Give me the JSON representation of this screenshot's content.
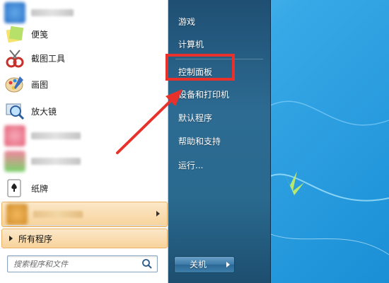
{
  "start_menu": {
    "programs": [
      {
        "label": "",
        "icon": "blurred-app-icon",
        "blurred": true
      },
      {
        "label": "便笺",
        "icon": "sticky-notes-icon"
      },
      {
        "label": "截图工具",
        "icon": "snipping-tool-icon"
      },
      {
        "label": "画图",
        "icon": "paint-icon"
      },
      {
        "label": "放大镜",
        "icon": "magnifier-icon"
      },
      {
        "label": "",
        "icon": "blurred-app-icon",
        "blurred": true
      },
      {
        "label": "",
        "icon": "blurred-app-icon",
        "blurred": true
      },
      {
        "label": "纸牌",
        "icon": "solitaire-icon"
      },
      {
        "label": "",
        "icon": "blurred-app-icon",
        "blurred": true,
        "has_submenu": true
      }
    ],
    "all_programs_label": "所有程序",
    "search": {
      "placeholder": "搜索程序和文件"
    },
    "right_items": [
      "游戏",
      "计算机",
      "控制面板",
      "设备和打印机",
      "默认程序",
      "帮助和支持",
      "运行..."
    ],
    "highlighted_item": "控制面板",
    "shutdown_label": "关机"
  },
  "colors": {
    "annotation_red": "#e8312b",
    "right_pane": "#2d6b92",
    "highlight": "#f8d39b"
  }
}
